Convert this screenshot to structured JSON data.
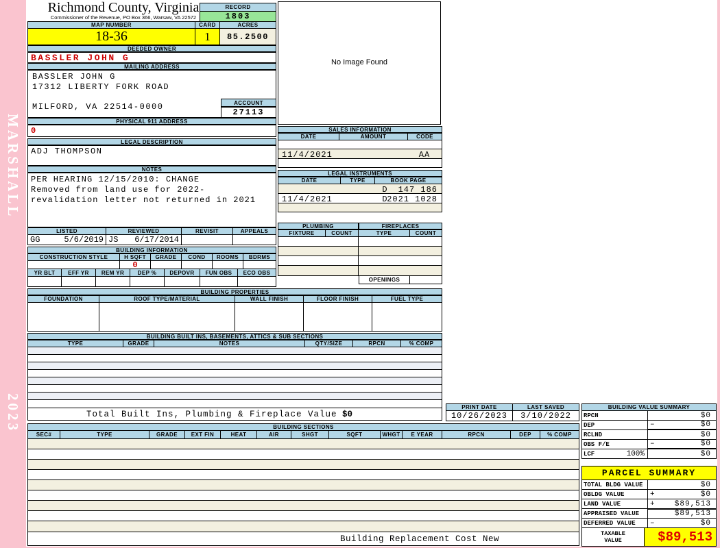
{
  "colors": {
    "page_pink": "#FAC4CF",
    "header_blue": "#B2D6E6",
    "record_green": "#98E698",
    "highlight_yellow": "#FFFF00",
    "ivory": "#F3F0E0",
    "alert_red": "#CC0000",
    "taxable_red": "#E00000"
  },
  "sidebar": {
    "vendor_text": "MARSHALL",
    "year_text": "2023"
  },
  "header": {
    "county_title": "Richmond County, Virginia",
    "county_subtitle": "Commissioner of the Revenue, PO Box 366, Warsaw, VA 22572",
    "record_label": "RECORD",
    "record_value": "1803",
    "map_number_label": "MAP NUMBER",
    "map_number": "18-36",
    "card_label": "CARD",
    "card_number": "1",
    "acres_label": "ACRES",
    "acres": "85.2500"
  },
  "owner": {
    "deeded_owner_label": "DEEDED OWNER",
    "deeded_owner": "BASSLER JOHN G",
    "mailing_address_label": "MAILING ADDRESS",
    "mailing_lines": [
      "BASSLER JOHN G",
      "17312 LIBERTY FORK ROAD",
      "MILFORD, VA 22514-0000"
    ],
    "account_label": "ACCOUNT",
    "account_number": "27113",
    "physical_911_label": "PHYSICAL 911 ADDRESS",
    "physical_911_value": "0"
  },
  "legal_description": {
    "label": "LEGAL DESCRIPTION",
    "value": "ADJ THOMPSON"
  },
  "notes": {
    "label": "NOTES",
    "lines": [
      "PER HEARING 12/15/2010: CHANGE",
      "Removed from land use for 2022-",
      "revalidation letter not returned in 2021"
    ]
  },
  "review": {
    "headers": [
      "LISTED",
      "REVIEWED",
      "REVISIT",
      "APPEALS"
    ],
    "listed_by": "GG",
    "listed_date": "5/6/2019",
    "reviewed_by": "JS",
    "reviewed_date": "6/17/2014",
    "revisit": "",
    "appeals": ""
  },
  "building_information": {
    "title": "BUILDING INFORMATION",
    "headers_row1": [
      "CONSTRUCTION STYLE",
      "H SQFT",
      "GRADE",
      "COND",
      "ROOMS",
      "BDRMS"
    ],
    "h_sqft_value": "0",
    "headers_row2": [
      "YR BLT",
      "EFF YR",
      "REM YR",
      "DEP %",
      "DEPOVR",
      "FUN OBS",
      "ECO OBS"
    ]
  },
  "building_properties": {
    "title": "BUILDING PROPERTIES",
    "headers": [
      "FOUNDATION",
      "ROOF TYPE/MATERIAL",
      "WALL FINISH",
      "FLOOR FINISH",
      "FUEL TYPE"
    ]
  },
  "built_ins": {
    "title": "BUILDING BUILT INS, BASEMENTS, ATTICS & SUB SECTIONS",
    "headers": [
      "TYPE",
      "GRADE",
      "NOTES",
      "QTY/SIZE",
      "RPCN",
      "% COMP"
    ],
    "total_label": "Total Built Ins, Plumbing & Fireplace Value",
    "total_value": "$0"
  },
  "image_panel": {
    "message": "No Image Found"
  },
  "sales_information": {
    "title": "SALES INFORMATION",
    "headers": [
      "DATE",
      "AMOUNT",
      "CODE"
    ],
    "rows": [
      {
        "date": "",
        "amount": "",
        "code": ""
      },
      {
        "date": "11/4/2021",
        "amount": "",
        "code": "AA"
      },
      {
        "date": "",
        "amount": "",
        "code": ""
      }
    ]
  },
  "legal_instruments": {
    "title": "LEGAL INSTRUMENTS",
    "headers": [
      "DATE",
      "TYPE",
      "BOOK PAGE"
    ],
    "rows": [
      {
        "date": "",
        "type": "D",
        "book_page": "147 186"
      },
      {
        "date": "11/4/2021",
        "type": "D",
        "book_page": "2021 1028"
      },
      {
        "date": "",
        "type": "",
        "book_page": ""
      }
    ]
  },
  "plumbing": {
    "title": "PLUMBING",
    "headers": [
      "FIXTURE",
      "COUNT"
    ]
  },
  "fireplaces": {
    "title": "FIREPLACES",
    "headers": [
      "TYPE",
      "COUNT"
    ],
    "openings_label": "OPENINGS"
  },
  "print_info": {
    "print_date_label": "PRINT DATE",
    "print_date": "10/26/2023",
    "last_saved_label": "LAST SAVED",
    "last_saved": "3/10/2022"
  },
  "building_value_summary": {
    "title": "BUILDING VALUE SUMMARY",
    "rows": [
      {
        "label": "RPCN",
        "pct": "",
        "op": "",
        "value": "$0"
      },
      {
        "label": "DEP",
        "pct": "",
        "op": "–",
        "value": "$0"
      },
      {
        "label": "RCLND",
        "pct": "",
        "op": "",
        "value": "$0"
      },
      {
        "label": "OBS F/E",
        "pct": "",
        "op": "–",
        "value": "$0"
      },
      {
        "label": "LCF",
        "pct": "100%",
        "op": "",
        "value": "$0"
      }
    ]
  },
  "building_sections": {
    "title": "BUILDING SECTIONS",
    "headers": [
      "SEC#",
      "TYPE",
      "GRADE",
      "EXT FIN",
      "HEAT",
      "AIR",
      "SHGT",
      "SQFT",
      "WHGT",
      "E YEAR",
      "RPCN",
      "DEP",
      "% COMP"
    ],
    "footer_text": "Building Replacement Cost New"
  },
  "parcel_summary": {
    "title": "PARCEL SUMMARY",
    "rows": [
      {
        "label": "TOTAL BLDG VALUE",
        "op": "",
        "value": "$0"
      },
      {
        "label": "OBLDG VALUE",
        "op": "+",
        "value": "$0"
      },
      {
        "label": "LAND VALUE",
        "op": "+",
        "value": "$89,513"
      },
      {
        "label": "APPRAISED VALUE",
        "op": "",
        "value": "$89,513"
      },
      {
        "label": "DEFERRED VALUE",
        "op": "–",
        "value": "$0"
      }
    ],
    "taxable_label": "TAXABLE VALUE",
    "taxable_value": "$89,513"
  }
}
